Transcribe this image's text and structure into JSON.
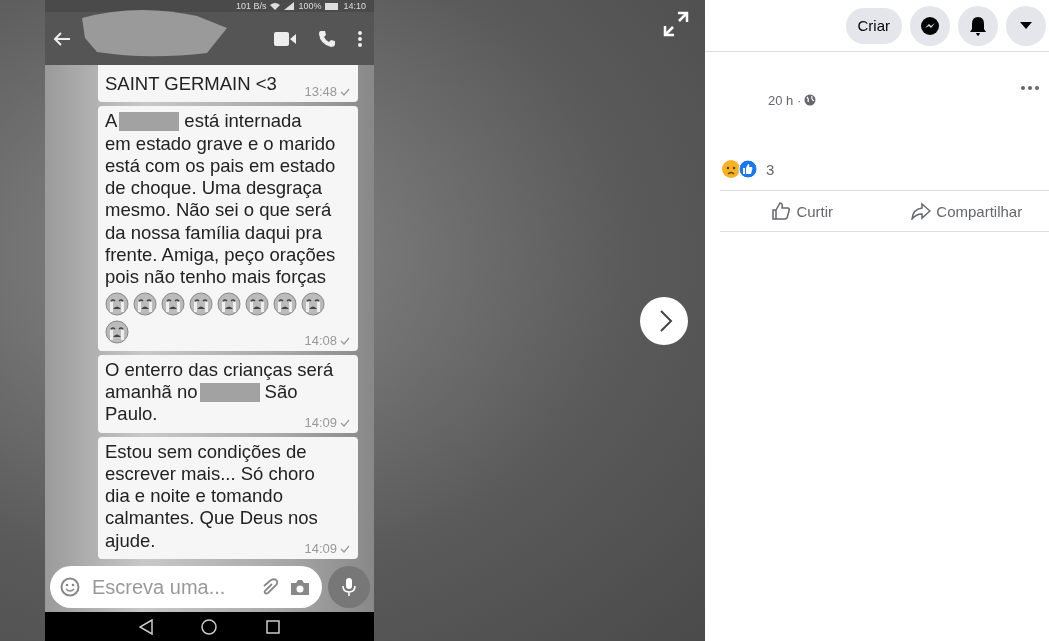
{
  "photo": {
    "status_bar": {
      "speed": "101 B/s",
      "battery": "100%",
      "time": "14:10"
    },
    "messages": [
      {
        "lines": [
          [
            {
              "kind": "text",
              "text": "SAINT GERMAIN <3"
            }
          ]
        ],
        "time": "13:48"
      },
      {
        "lines": [
          [
            {
              "kind": "text",
              "text": "A"
            },
            {
              "kind": "redaction"
            },
            {
              "kind": "text",
              "text": "está internada"
            }
          ],
          [
            {
              "kind": "text",
              "text": "em estado grave e o marido"
            }
          ],
          [
            {
              "kind": "text",
              "text": "está com os pais em estado"
            }
          ],
          [
            {
              "kind": "text",
              "text": "de choque. Uma desgraça"
            }
          ],
          [
            {
              "kind": "text",
              "text": "mesmo. Não sei o que será"
            }
          ],
          [
            {
              "kind": "text",
              "text": "da nossa família daqui pra"
            }
          ],
          [
            {
              "kind": "text",
              "text": "frente. Amiga, peço orações"
            }
          ],
          [
            {
              "kind": "text",
              "text": "pois não tenho mais forças"
            }
          ]
        ],
        "emojis": [
          {
            "kind": "crying"
          },
          {
            "kind": "crying"
          },
          {
            "kind": "crying"
          },
          {
            "kind": "crying"
          },
          {
            "kind": "crying"
          },
          {
            "kind": "crying"
          },
          {
            "kind": "crying"
          },
          {
            "kind": "crying"
          },
          {
            "kind": "crying"
          }
        ],
        "time": "14:08"
      },
      {
        "lines": [
          [
            {
              "kind": "text",
              "text": "O enterro das crianças será"
            }
          ],
          [
            {
              "kind": "text",
              "text": "amanhã no"
            },
            {
              "kind": "redaction"
            },
            {
              "kind": "text",
              "text": "São"
            }
          ],
          [
            {
              "kind": "text",
              "text": "Paulo."
            }
          ]
        ],
        "time": "14:09"
      },
      {
        "lines": [
          [
            {
              "kind": "text",
              "text": "Estou sem condições de"
            }
          ],
          [
            {
              "kind": "text",
              "text": "escrever mais... Só choro"
            }
          ],
          [
            {
              "kind": "text",
              "text": "dia e noite e tomando"
            }
          ],
          [
            {
              "kind": "text",
              "text": "calmantes. Que Deus nos"
            }
          ],
          [
            {
              "kind": "text",
              "text": "ajude."
            }
          ]
        ],
        "time": "14:09"
      }
    ],
    "composer": {
      "placeholder": "Escreva uma..."
    }
  },
  "topbar": {
    "create": "Criar"
  },
  "post": {
    "time": "20 h ·",
    "reaction_count": "3",
    "actions": [
      {
        "kind": "like",
        "label": "Curtir"
      },
      {
        "kind": "share",
        "label": "Compartilhar"
      }
    ]
  }
}
